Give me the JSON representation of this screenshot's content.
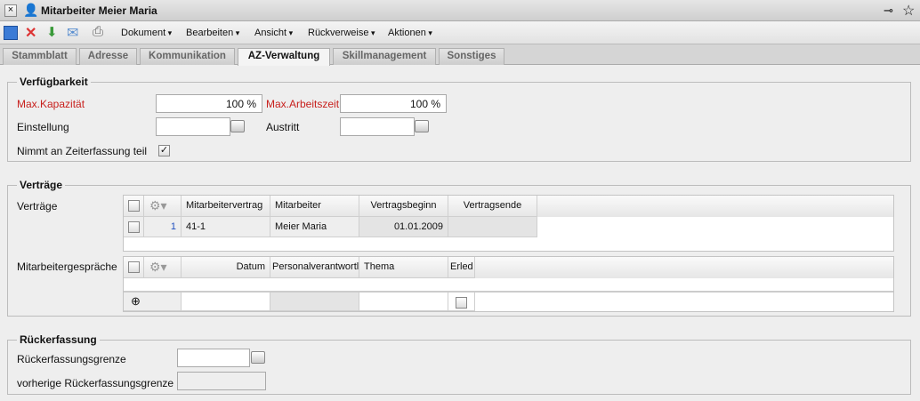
{
  "window": {
    "title": "Mitarbeiter Meier Maria"
  },
  "toolbar": {
    "menus": [
      "Dokument",
      "Bearbeiten",
      "Ansicht",
      "Rückverweise",
      "Aktionen"
    ]
  },
  "tabs": [
    "Stammblatt",
    "Adresse",
    "Kommunikation",
    "AZ-Verwaltung",
    "Skillmanagement",
    "Sonstiges"
  ],
  "verfuegbarkeit": {
    "legend": "Verfügbarkeit",
    "max_kapazitaet_label": "Max.Kapazität",
    "max_kapazitaet": "100 %",
    "max_arbeitszeit_label": "Max.Arbeitszeit",
    "max_arbeitszeit": "100 %",
    "einstellung_label": "Einstellung",
    "einstellung": "",
    "austritt_label": "Austritt",
    "austritt": "",
    "zeiterfassung_label": "Nimmt an Zeiterfassung teil",
    "zeiterfassung_checked": true
  },
  "vertraege": {
    "legend": "Verträge",
    "grid_label": "Verträge",
    "columns": [
      "Mitarbeitervertrag",
      "Mitarbeiter",
      "Vertragsbeginn",
      "Vertragsende"
    ],
    "rows": [
      {
        "num": "1",
        "vertrag": "41-1",
        "mitarbeiter": "Meier Maria",
        "beginn": "01.01.2009",
        "ende": ""
      }
    ],
    "gespraeche_label": "Mitarbeitergespräche",
    "gespraeche_columns": [
      "Datum",
      "Personalverantwortl",
      "Thema",
      "Erled"
    ]
  },
  "rueckerfassung": {
    "legend": "Rückerfassung",
    "grenze_label": "Rückerfassungsgrenze",
    "grenze": "",
    "vorherige_label": "vorherige Rückerfassungsgrenze",
    "vorherige": ""
  }
}
